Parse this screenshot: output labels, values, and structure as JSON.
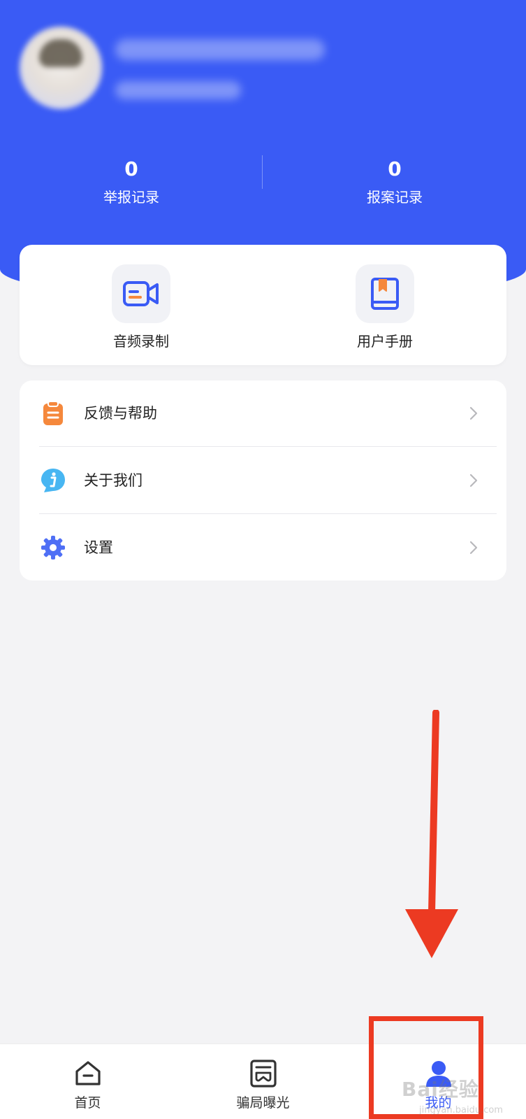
{
  "header": {
    "stats": [
      {
        "value": "0",
        "label": "举报记录"
      },
      {
        "value": "0",
        "label": "报案记录"
      }
    ]
  },
  "tools": [
    {
      "label": "音频录制",
      "icon": "video-camera-icon"
    },
    {
      "label": "用户手册",
      "icon": "book-icon"
    }
  ],
  "menu": [
    {
      "label": "反馈与帮助",
      "icon": "clipboard-icon"
    },
    {
      "label": "关于我们",
      "icon": "info-icon"
    },
    {
      "label": "设置",
      "icon": "gear-icon"
    }
  ],
  "tabbar": [
    {
      "label": "首页",
      "icon": "home-icon"
    },
    {
      "label": "骗局曝光",
      "icon": "newspaper-icon"
    },
    {
      "label": "我的",
      "icon": "user-icon",
      "active": true
    }
  ],
  "watermark": {
    "text": "Bai经验",
    "sub": "jingyan.baidu.com"
  },
  "colors": {
    "primary": "#3a5bf5",
    "annotation": "#ec3a22",
    "orange": "#f5883c"
  }
}
